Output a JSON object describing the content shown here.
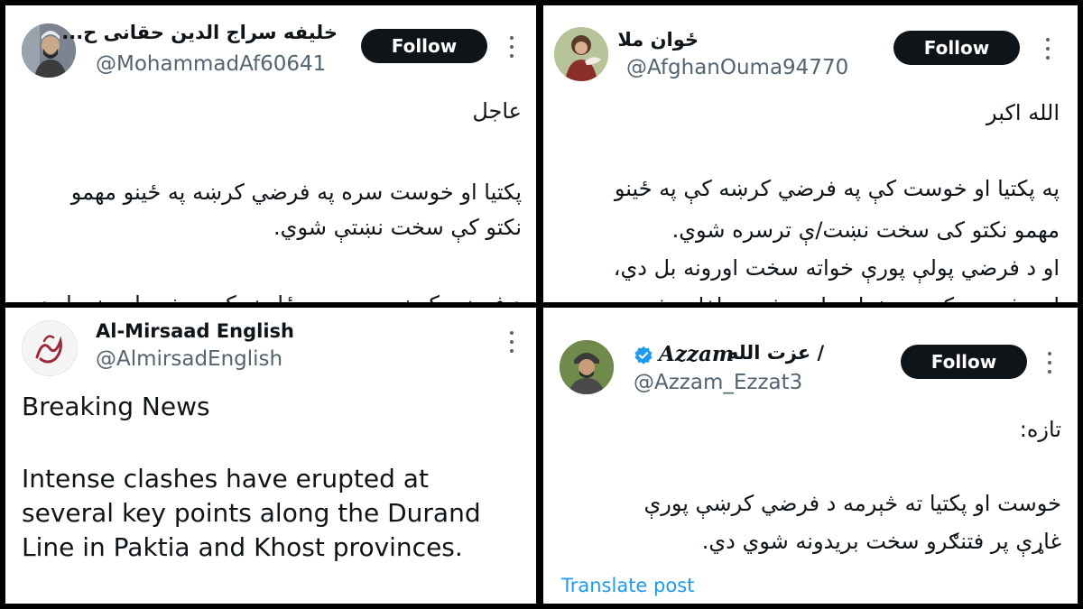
{
  "panel1": {
    "name": "خلیفه سراج الدین حقانی ح...",
    "handle": "@MohammadAf60641",
    "follow_label": "Follow",
    "avatar_icon": "bearded-man-portrait",
    "lines": [
      "عاجل",
      "پکتیا او خوست سره په فرضي کرښه په ځینو مهمو",
      "نکتو کې سخت نښتې شوي.",
      "د فرضي کرښې په مهمو ځایونو کې سخت اورونه بل دي."
    ]
  },
  "panel2": {
    "name": "ځوان ملا",
    "handle": "@AfghanOuma94770",
    "follow_label": "Follow",
    "avatar_icon": "portrait-with-bird",
    "lines": [
      "الله اکبر",
      "په پکتیا او خوست کې په فرضي کرښه کې په ځینو",
      "مهمو نکتو کی سخت نښت/ې ترسره شوي.",
      "او د فرضي پولې پورې خواته سخت اورونه بل دي،",
      "او د فرضي کرښې خوا ته لوی شمیر تلفات شوي دي."
    ]
  },
  "panel3": {
    "name": "Al-Mirsaad English",
    "handle": "@AlmirsadEnglish",
    "avatar_icon": "calligraphy-logo",
    "lines": [
      "Breaking News",
      "Intense clashes have erupted at",
      "several key points along the Durand",
      "Line in Paktia and Khost provinces."
    ]
  },
  "panel4": {
    "name_latin": "Azzam",
    "name_arabic": "/ عزت الله",
    "handle": "@Azzam_Ezzat3",
    "follow_label": "Follow",
    "verified_icon": "verified-badge-icon",
    "avatar_icon": "man-in-turban-portrait",
    "lines": [
      "تازه:",
      "خوست او پکتیا ته څېرمه د فرضي کرښې پورې",
      "غاړې پر فتنګرو سخت بریدونه شوي دي."
    ],
    "translate_label": "Translate post"
  },
  "colors": {
    "follow_bg": "#0f1419",
    "handle": "#536471",
    "link": "#1d9bf0",
    "verified": "#1d9bf0"
  }
}
